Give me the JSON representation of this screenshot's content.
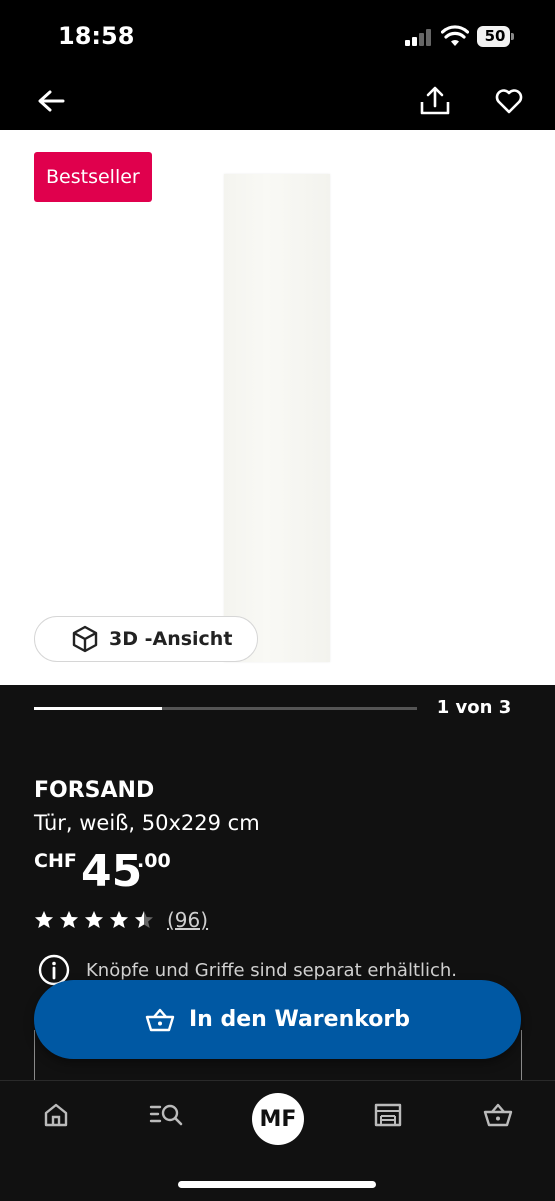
{
  "status": {
    "time": "18:58",
    "battery": "50"
  },
  "badge": "Bestseller",
  "view_3d_label": "3D -Ansicht",
  "gallery": {
    "pager": "1 von 3",
    "current": 1,
    "total": 3
  },
  "product": {
    "name": "FORSAND",
    "description": "Tür, weiß, 50x229 cm",
    "price_currency": "CHF",
    "price_integer": "45",
    "price_decimal": ".00",
    "rating": 4.5,
    "rating_count": "(96)",
    "info": "Knöpfe und Griffe sind separat erhältlich."
  },
  "cart_button": "In den Warenkorb",
  "avatar_initials": "MF",
  "icons": [
    "back-arrow-icon",
    "share-icon",
    "heart-icon",
    "cube-icon",
    "star-icon",
    "info-icon",
    "basket-icon",
    "home-icon",
    "search-list-icon",
    "store-icon"
  ],
  "colors": {
    "badge": "#e0004d",
    "cart_button": "#0058a3",
    "background": "#111111"
  }
}
